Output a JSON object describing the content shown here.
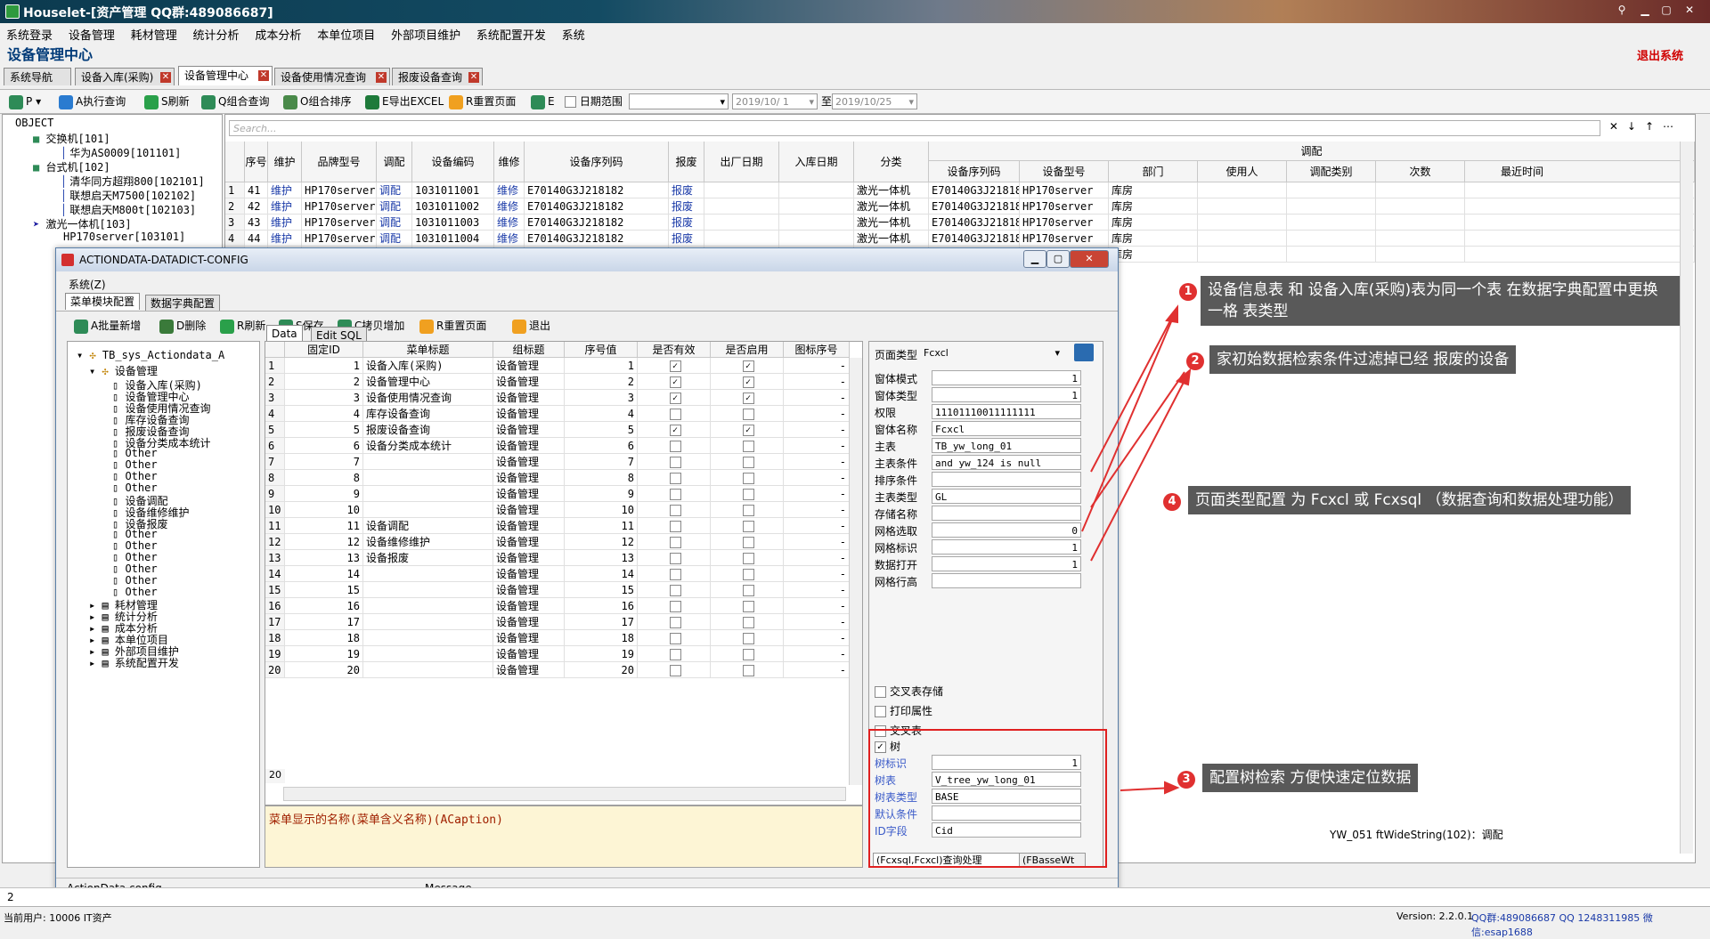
{
  "window": {
    "title": "Houselet-[资产管理 QQ群:489086687]"
  },
  "menu": [
    "系统登录",
    "设备管理",
    "耗材管理",
    "统计分析",
    "成本分析",
    "本单位项目",
    "外部项目维护",
    "系统配置开发",
    "系统"
  ],
  "app_title": "设备管理中心",
  "exit_label": "退出系统",
  "tabs": [
    "系统导航",
    "设备入库(采购)",
    "设备管理中心",
    "设备使用情况查询",
    "报废设备查询"
  ],
  "toolbar": {
    "print": "P",
    "execute": "A执行查询",
    "refresh": "S刷新",
    "combo_query": "Q组合查询",
    "combo_sort": "O组合排序",
    "export": "E导出EXCEL",
    "reset": "R重置页面",
    "e": "E",
    "date_range": "日期范围",
    "date_from": "2019/10/ 1",
    "to": "至",
    "date_to": "2019/10/25"
  },
  "left_tree": [
    {
      "label": "OBJECT",
      "level": 0
    },
    {
      "label": "交换机[101]",
      "level": 1
    },
    {
      "label": "华为AS0009[101101]",
      "level": 2
    },
    {
      "label": "台式机[102]",
      "level": 1
    },
    {
      "label": "清华同方超翔800[102101]",
      "level": 2
    },
    {
      "label": "联想启天M7500[102102]",
      "level": 2
    },
    {
      "label": "联想启天M800t[102103]",
      "level": 2
    },
    {
      "label": "激光一体机[103]",
      "level": 1
    },
    {
      "label": "HP170server[103101]",
      "level": 2
    }
  ],
  "main_grid": {
    "search_placeholder": "Search...",
    "headers": [
      "序号",
      "维护",
      "品牌型号",
      "调配",
      "设备编码",
      "维修",
      "设备序列码",
      "报废",
      "出厂日期",
      "入库日期",
      "分类"
    ],
    "group_header": "调配",
    "sub_headers": [
      "设备序列码",
      "设备型号",
      "部门",
      "使用人",
      "调配类别",
      "次数",
      "最近时间"
    ],
    "rows": [
      {
        "n": "1",
        "seq": "41",
        "m": "维护",
        "model": "HP170server",
        "dp": "调配",
        "code": "1031011001",
        "wx": "维修",
        "sn": "E70140G3J218182",
        "bf": "报废",
        "cat": "激光一体机",
        "sn2": "E70140G3J21818",
        "model2": "HP170server",
        "dept": "库房"
      },
      {
        "n": "2",
        "seq": "42",
        "m": "维护",
        "model": "HP170server",
        "dp": "调配",
        "code": "1031011002",
        "wx": "维修",
        "sn": "E70140G3J218182",
        "bf": "报废",
        "cat": "激光一体机",
        "sn2": "E70140G3J21818",
        "model2": "HP170server",
        "dept": "库房"
      },
      {
        "n": "3",
        "seq": "43",
        "m": "维护",
        "model": "HP170server",
        "dp": "调配",
        "code": "1031011003",
        "wx": "维修",
        "sn": "E70140G3J218182",
        "bf": "报废",
        "cat": "激光一体机",
        "sn2": "E70140G3J21818",
        "model2": "HP170server",
        "dept": "库房"
      },
      {
        "n": "4",
        "seq": "44",
        "m": "维护",
        "model": "HP170server",
        "dp": "调配",
        "code": "1031011004",
        "wx": "维修",
        "sn": "E70140G3J218182",
        "bf": "报废",
        "cat": "激光一体机",
        "sn2": "E70140G3J21818",
        "model2": "HP170server",
        "dept": "库房"
      },
      {
        "n": "",
        "seq": "",
        "m": "",
        "model": "",
        "dp": "",
        "code": "",
        "wx": "",
        "sn": "",
        "bf": "",
        "cat": "",
        "sn2": "E70140G3J21818",
        "model2": "HP170server",
        "dept": "库房"
      }
    ]
  },
  "dialog": {
    "title": "ACTIONDATA-DATADICT-CONFIG",
    "menu": "系统(Z)",
    "tabs": [
      "菜单模块配置",
      "数据字典配置"
    ],
    "toolbar": [
      "A批量新增",
      "D删除",
      "R刷新",
      "S保存",
      "C拷贝增加",
      "R重置页面",
      "退出"
    ],
    "tree_root": "TB_sys_Actiondata_A",
    "tree_group": "设备管理",
    "tree_items": [
      "设备入库(采购)",
      "设备管理中心",
      "设备使用情况查询",
      "库存设备查询",
      "报废设备查询",
      "设备分类成本统计",
      "Other",
      "Other",
      "Other",
      "Other",
      "设备调配",
      "设备维修维护",
      "设备报废",
      "Other",
      "Other",
      "Other",
      "Other",
      "Other",
      "Other"
    ],
    "tree_groups_after": [
      "耗材管理",
      "统计分析",
      "成本分析",
      "本单位项目",
      "外部项目维护",
      "系统配置开发"
    ],
    "grid_tabs": [
      "Data",
      "Edit SQL"
    ],
    "grid_headers": [
      "固定ID",
      "菜单标题",
      "组标题",
      "序号值",
      "是否有效",
      "是否启用",
      "图标序号"
    ],
    "grid_rows": [
      {
        "n": "1",
        "id": "1",
        "title": "设备入库(采购)",
        "group": "设备管理",
        "seq": "1",
        "valid": true,
        "enabled": true
      },
      {
        "n": "2",
        "id": "2",
        "title": "设备管理中心",
        "group": "设备管理",
        "seq": "2",
        "valid": true,
        "enabled": true
      },
      {
        "n": "3",
        "id": "3",
        "title": "设备使用情况查询",
        "group": "设备管理",
        "seq": "3",
        "valid": true,
        "enabled": true
      },
      {
        "n": "4",
        "id": "4",
        "title": "库存设备查询",
        "group": "设备管理",
        "seq": "4",
        "valid": false,
        "enabled": false
      },
      {
        "n": "5",
        "id": "5",
        "title": "报废设备查询",
        "group": "设备管理",
        "seq": "5",
        "valid": true,
        "enabled": true
      },
      {
        "n": "6",
        "id": "6",
        "title": "设备分类成本统计",
        "group": "设备管理",
        "seq": "6",
        "valid": false,
        "enabled": false
      },
      {
        "n": "7",
        "id": "7",
        "title": "",
        "group": "设备管理",
        "seq": "7",
        "valid": false,
        "enabled": false
      },
      {
        "n": "8",
        "id": "8",
        "title": "",
        "group": "设备管理",
        "seq": "8",
        "valid": false,
        "enabled": false
      },
      {
        "n": "9",
        "id": "9",
        "title": "",
        "group": "设备管理",
        "seq": "9",
        "valid": false,
        "enabled": false
      },
      {
        "n": "10",
        "id": "10",
        "title": "",
        "group": "设备管理",
        "seq": "10",
        "valid": false,
        "enabled": false
      },
      {
        "n": "11",
        "id": "11",
        "title": "设备调配",
        "group": "设备管理",
        "seq": "11",
        "valid": false,
        "enabled": false
      },
      {
        "n": "12",
        "id": "12",
        "title": "设备维修维护",
        "group": "设备管理",
        "seq": "12",
        "valid": false,
        "enabled": false
      },
      {
        "n": "13",
        "id": "13",
        "title": "设备报废",
        "group": "设备管理",
        "seq": "13",
        "valid": false,
        "enabled": false
      },
      {
        "n": "14",
        "id": "14",
        "title": "",
        "group": "设备管理",
        "seq": "14",
        "valid": false,
        "enabled": false
      },
      {
        "n": "15",
        "id": "15",
        "title": "",
        "group": "设备管理",
        "seq": "15",
        "valid": false,
        "enabled": false
      },
      {
        "n": "16",
        "id": "16",
        "title": "",
        "group": "设备管理",
        "seq": "16",
        "valid": false,
        "enabled": false
      },
      {
        "n": "17",
        "id": "17",
        "title": "",
        "group": "设备管理",
        "seq": "17",
        "valid": false,
        "enabled": false
      },
      {
        "n": "18",
        "id": "18",
        "title": "",
        "group": "设备管理",
        "seq": "18",
        "valid": false,
        "enabled": false
      },
      {
        "n": "19",
        "id": "19",
        "title": "",
        "group": "设备管理",
        "seq": "19",
        "valid": false,
        "enabled": false
      },
      {
        "n": "20",
        "id": "20",
        "title": "",
        "group": "设备管理",
        "seq": "20",
        "valid": false,
        "enabled": false
      }
    ],
    "grid_footer_count": "20",
    "message": "菜单显示的名称(菜单含义名称)(ACaption)",
    "props": {
      "page_type_label": "页面类型",
      "page_type_value": "Fcxcl",
      "fields": [
        {
          "label": "窗体模式",
          "value": "1",
          "align": "right"
        },
        {
          "label": "窗体类型",
          "value": "1",
          "align": "right"
        },
        {
          "label": "权限",
          "value": "11101110011111111",
          "align": "left"
        },
        {
          "label": "窗体名称",
          "value": "Fcxcl",
          "align": "left"
        },
        {
          "label": "主表",
          "value": "TB_yw_long_01",
          "align": "left"
        },
        {
          "label": "主表条件",
          "value": "and yw_124 is null",
          "align": "left"
        },
        {
          "label": "排序条件",
          "value": "",
          "align": "left"
        },
        {
          "label": "主表类型",
          "value": "GL",
          "align": "left"
        },
        {
          "label": "存储名称",
          "value": "",
          "align": "left"
        },
        {
          "label": "网格选取",
          "value": "0",
          "align": "right"
        },
        {
          "label": "网格标识",
          "value": "1",
          "align": "right"
        },
        {
          "label": "数据打开",
          "value": "1",
          "align": "right"
        },
        {
          "label": "网格行高",
          "value": "",
          "align": "left"
        }
      ],
      "checks": [
        "交叉表存储",
        "打印属性",
        "交叉表"
      ],
      "tree_check": "树",
      "tree_fields": [
        {
          "label": "树标识",
          "value": "1",
          "align": "right"
        },
        {
          "label": "树表",
          "value": "V_tree_yw_long_01",
          "align": "left"
        },
        {
          "label": "树表类型",
          "value": "BASE",
          "align": "left"
        },
        {
          "label": "默认条件",
          "value": "",
          "align": "left"
        },
        {
          "label": "ID字段",
          "value": "Cid",
          "align": "left"
        }
      ],
      "bottom_tabs": [
        "(Fcxsql,Fcxcl)查询处理",
        "(FBasseWt"
      ]
    },
    "status_left": "ActionData  config",
    "status_mid": "Message"
  },
  "annotations": [
    {
      "num": "1",
      "text": "设备信息表 和 设备入库(采购)表为同一个表 在数据字典配置中更换一格 表类型"
    },
    {
      "num": "2",
      "text": "家初始数据检索条件过滤掉已经 报废的设备"
    },
    {
      "num": "3",
      "text": "配置树检索 方便快速定位数据"
    },
    {
      "num": "4",
      "text": "页面类型配置 为 Fcxcl 或 Fcxsql （数据查询和数据处理功能）"
    }
  ],
  "right_status": "YW_051 ftWideString(102)：调配",
  "statusbar": {
    "left_num": "2",
    "user": "当前用户: 10006 IT资产",
    "version": "Version: 2.2.0.1",
    "qq": "QQ群:489086687 QQ  1248311985 微信:esap1688"
  },
  "colors": {
    "accent_red": "#e03030",
    "note_bg": "#595959",
    "title_blue": "#003a78"
  }
}
